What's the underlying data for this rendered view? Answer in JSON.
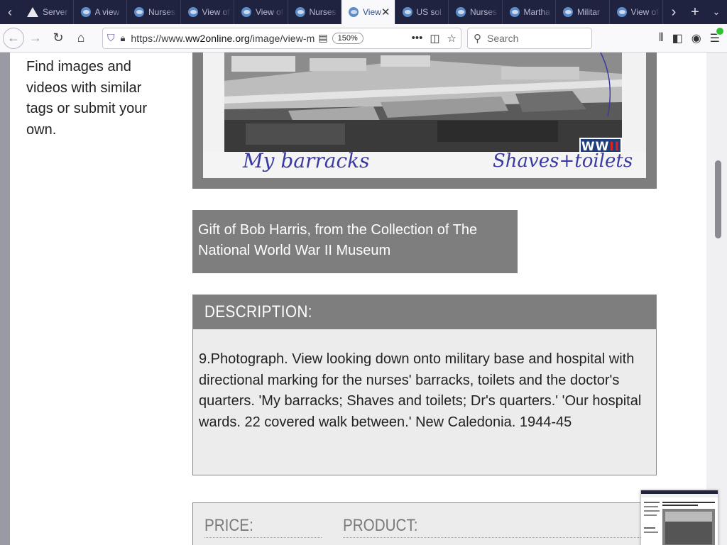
{
  "browser": {
    "tabs": [
      {
        "title": "Server"
      },
      {
        "title": "A view"
      },
      {
        "title": "Nurses"
      },
      {
        "title": "View of"
      },
      {
        "title": "View of"
      },
      {
        "title": "Nurses"
      },
      {
        "title": "View",
        "active": true
      },
      {
        "title": "US sol"
      },
      {
        "title": "Nurses"
      },
      {
        "title": "Martha"
      },
      {
        "title": "Militar"
      },
      {
        "title": "View of"
      }
    ],
    "url_prefix": "https://www.",
    "url_domain": "ww2online.org",
    "url_path": "/image/view-m",
    "zoom": "150%",
    "search_placeholder": "Search"
  },
  "page": {
    "side_text": "Find images and videos with similar tags or submit your own.",
    "photo_captions": {
      "left": "My barracks",
      "right": "Shaves+toilets"
    },
    "watermark": "WWII",
    "credit": "Gift of Bob Harris, from the Collection of The National World War II Museum",
    "description_heading": "DESCRIPTION:",
    "description": "9.Photograph. View looking down onto military base and hospital with directional marking for the nurses' barracks, toilets and the doctor's quarters. 'My barracks; Shaves and toilets; Dr's quarters.' 'Our hospital wards. 22 covered walk between.' New Caledonia. 1944-45",
    "price_label": "PRICE:",
    "product_label": "PRODUCT:"
  },
  "colors": {
    "panel": "#7e7e7e",
    "panel_light": "#ececec",
    "tabstrip": "#202340"
  }
}
